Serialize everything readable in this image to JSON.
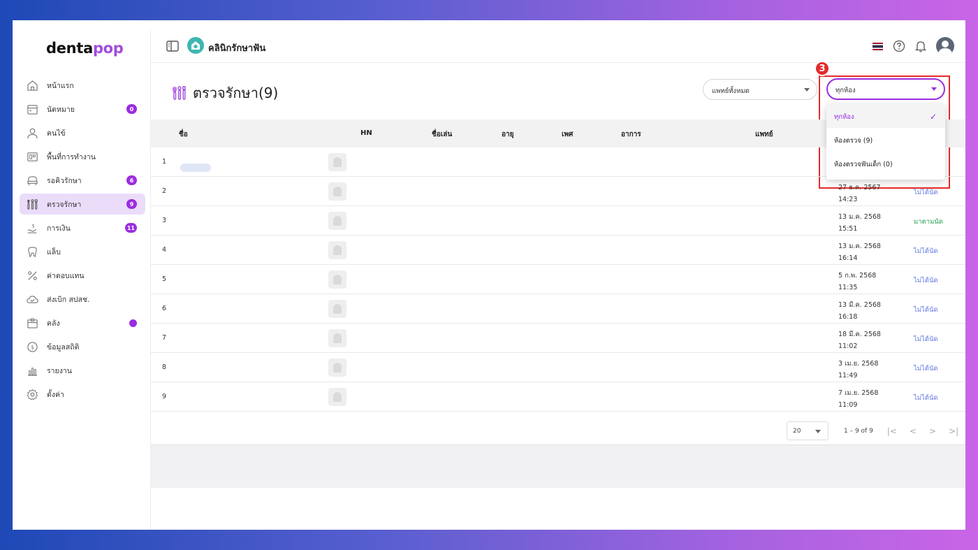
{
  "brand": {
    "logo_main": "denta",
    "logo_accent": "pop"
  },
  "clinic": {
    "name": "คลินิกรักษาฟัน"
  },
  "sidebar": {
    "items": [
      {
        "label": "หน้าแรก",
        "icon": "home-icon",
        "badge": ""
      },
      {
        "label": "นัดหมาย",
        "icon": "calendar-icon",
        "badge": "0"
      },
      {
        "label": "คนไข้",
        "icon": "person-icon",
        "badge": ""
      },
      {
        "label": "พื้นที่การทำงาน",
        "icon": "workspace-icon",
        "badge": ""
      },
      {
        "label": "รอคิวรักษา",
        "icon": "chair-icon",
        "badge": "6"
      },
      {
        "label": "ตรวจรักษา",
        "icon": "tools-icon",
        "badge": "9"
      },
      {
        "label": "การเงิน",
        "icon": "money-icon",
        "badge": "11"
      },
      {
        "label": "แล็บ",
        "icon": "tooth-icon",
        "badge": ""
      },
      {
        "label": "ค่าตอบแทน",
        "icon": "percent-icon",
        "badge": ""
      },
      {
        "label": "ส่งเบิก สปสช.",
        "icon": "cloud-icon",
        "badge": ""
      },
      {
        "label": "คลัง",
        "icon": "box-icon",
        "badge": "dot"
      },
      {
        "label": "ข้อมูลสถิติ",
        "icon": "stats-icon",
        "badge": ""
      },
      {
        "label": "รายงาน",
        "icon": "report-icon",
        "badge": ""
      },
      {
        "label": "ตั้งค่า",
        "icon": "settings-icon",
        "badge": ""
      }
    ]
  },
  "page": {
    "title": "ตรวจรักษา(9)"
  },
  "filters": {
    "doctor": "แพทย์ทั้งหมด",
    "room": "ทุกห้อง",
    "room_options": [
      {
        "label": "ทุกห้อง",
        "selected": true
      },
      {
        "label": "ห้องตรวจ (9)",
        "selected": false
      },
      {
        "label": "ห้องตรวจฟันเด็ก (0)",
        "selected": false
      }
    ]
  },
  "step_marker": "3",
  "table": {
    "headers": {
      "name": "ชื่อ",
      "hn": "HN",
      "nickname": "ชื่อเล่น",
      "age": "อายุ",
      "sex": "เพศ",
      "symptom": "อาการ",
      "doctor": "แพทย์"
    },
    "rows": [
      {
        "no": "1",
        "date": "",
        "time": "",
        "status": "",
        "status_ok": false
      },
      {
        "no": "2",
        "date": "27 ธ.ค. 2567",
        "time": "14:23",
        "status": "ไม่ได้นัด",
        "status_ok": false
      },
      {
        "no": "3",
        "date": "13 ม.ค. 2568",
        "time": "15:51",
        "status": "มาตามนัด",
        "status_ok": true
      },
      {
        "no": "4",
        "date": "13 ม.ค. 2568",
        "time": "16:14",
        "status": "ไม่ได้นัด",
        "status_ok": false
      },
      {
        "no": "5",
        "date": "5 ก.พ. 2568",
        "time": "11:35",
        "status": "ไม่ได้นัด",
        "status_ok": false
      },
      {
        "no": "6",
        "date": "13 มี.ค. 2568",
        "time": "16:18",
        "status": "ไม่ได้นัด",
        "status_ok": false
      },
      {
        "no": "7",
        "date": "18 มี.ค. 2568",
        "time": "11:02",
        "status": "ไม่ได้นัด",
        "status_ok": false
      },
      {
        "no": "8",
        "date": "3 เม.ย. 2568",
        "time": "11:49",
        "status": "ไม่ได้นัด",
        "status_ok": false
      },
      {
        "no": "9",
        "date": "7 เม.ย. 2568",
        "time": "11:09",
        "status": "ไม่ได้นัด",
        "status_ok": false
      }
    ]
  },
  "pagination": {
    "rows_per_page": "20",
    "range": "1 – 9 of 9"
  },
  "colors": {
    "accent": "#9b2de0",
    "highlight": "#e52b2b",
    "status_ok": "#2ea44f",
    "status_link": "#6279e0"
  }
}
